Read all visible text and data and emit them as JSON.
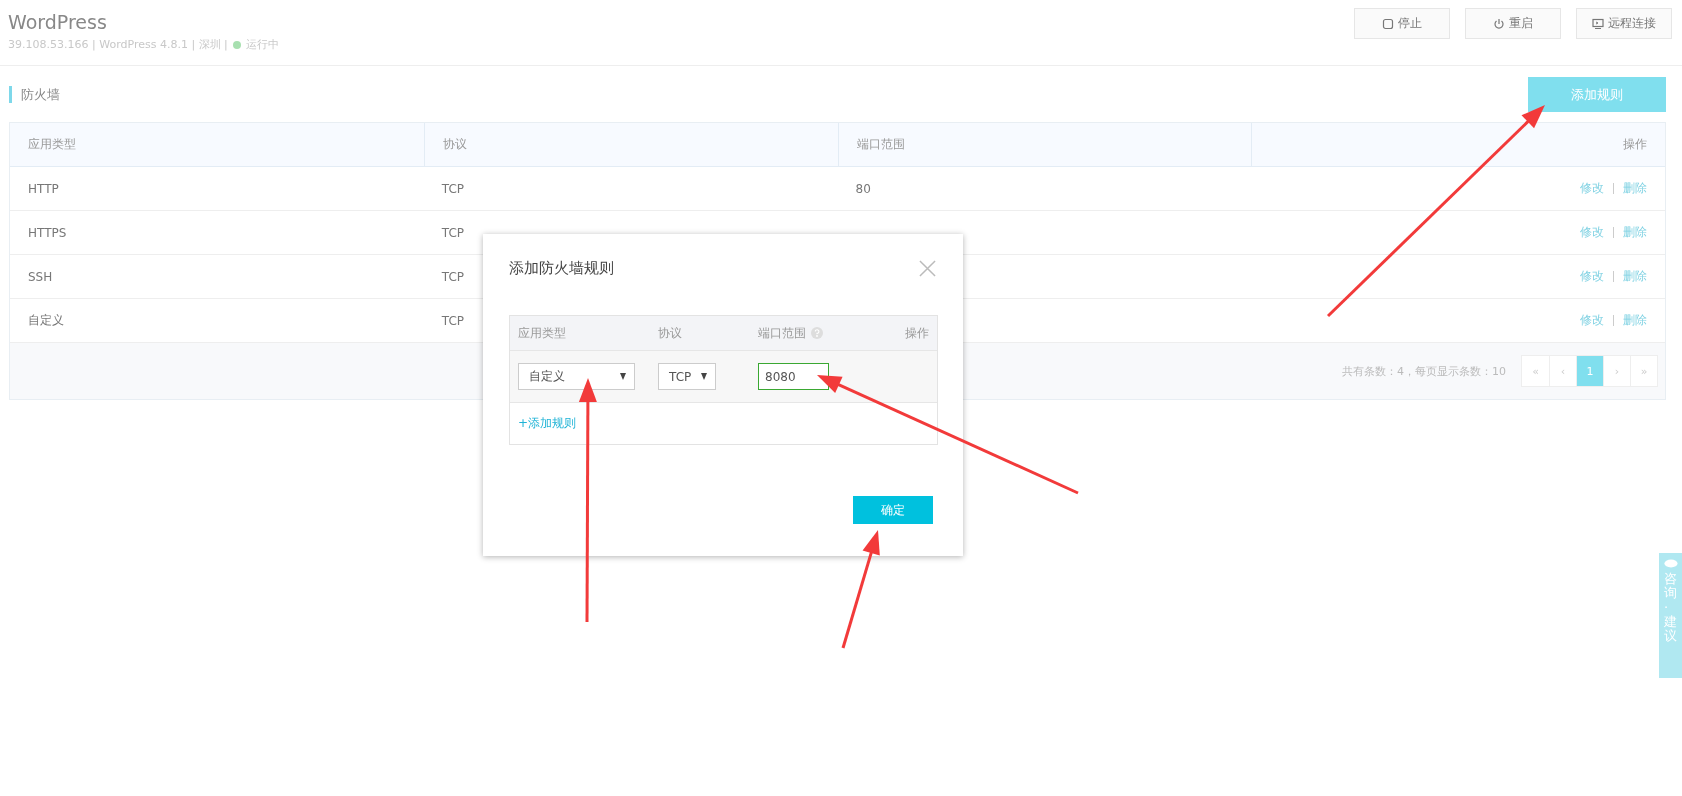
{
  "header": {
    "title": "WordPress",
    "info": "39.108.53.166 | WordPress 4.8.1 | 深圳 |",
    "status": "运行中",
    "buttons": [
      {
        "kind": "stop",
        "label": "停止"
      },
      {
        "kind": "power",
        "label": "重启"
      },
      {
        "kind": "monitor",
        "label": "远程连接"
      }
    ]
  },
  "section": {
    "title": "防火墙",
    "add_button": "添加规则"
  },
  "table": {
    "columns": [
      "应用类型",
      "协议",
      "端口范围",
      "操作"
    ],
    "rows": [
      {
        "type": "HTTP",
        "protocol": "TCP",
        "port": "80",
        "actions": [
          "修改",
          "删除"
        ]
      },
      {
        "type": "HTTPS",
        "protocol": "TCP",
        "actions": [
          "修改",
          "删除"
        ]
      },
      {
        "type": "SSH",
        "protocol": "TCP",
        "actions": [
          "修改",
          "删除"
        ]
      },
      {
        "type": "自定义",
        "protocol": "TCP",
        "actions": [
          "修改",
          "删除"
        ]
      }
    ],
    "summary": "共有条数：4，每页显示条数：10",
    "pages": [
      {
        "label": "«",
        "selected": false
      },
      {
        "label": "‹",
        "selected": false
      },
      {
        "label": "1",
        "selected": true
      },
      {
        "label": "›",
        "selected": false
      },
      {
        "label": "»",
        "selected": false
      }
    ]
  },
  "dialog": {
    "title": "添加防火墙规则",
    "columns": [
      "应用类型",
      "协议",
      "端口范围",
      "操作"
    ],
    "row": {
      "type": "自定义",
      "protocol": "TCP",
      "port": "8080"
    },
    "add_link": "+添加规则",
    "confirm": "确定"
  },
  "side_tab": {
    "label": "咨询·建议"
  }
}
